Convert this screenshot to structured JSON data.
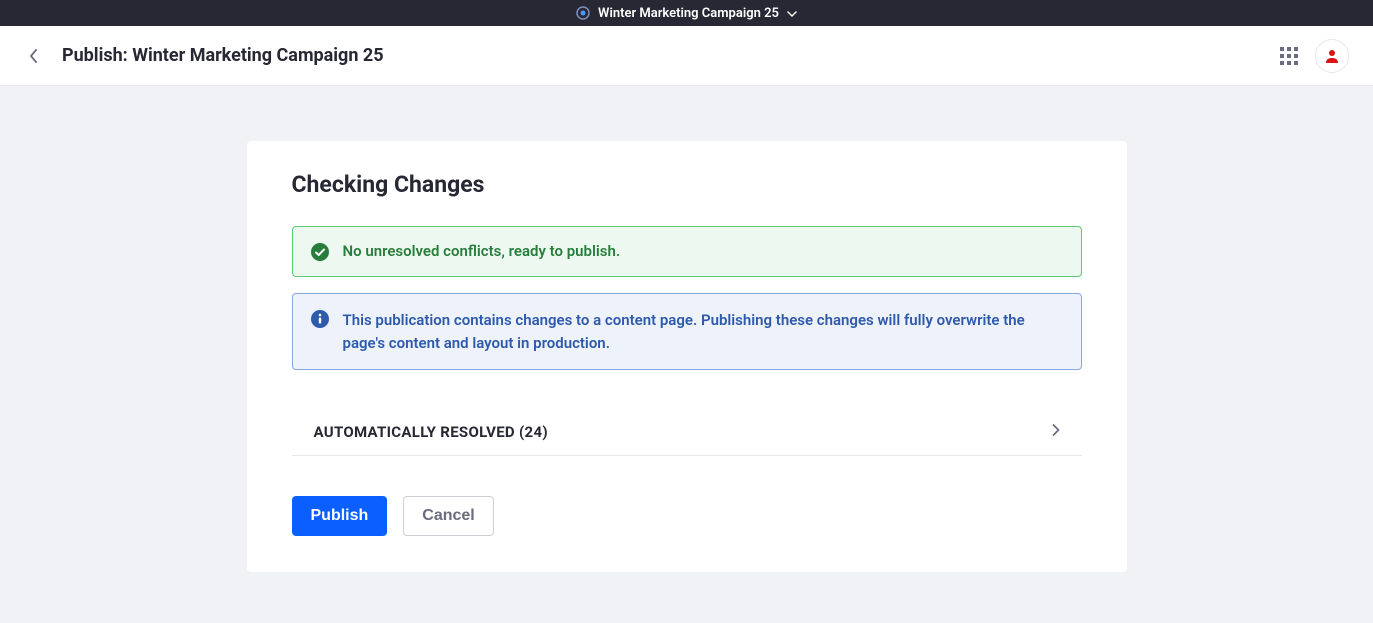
{
  "topbar": {
    "title": "Winter Marketing Campaign 25"
  },
  "header": {
    "title": "Publish: Winter Marketing Campaign 25"
  },
  "card": {
    "title": "Checking Changes",
    "success_message": "No unresolved conflicts, ready to publish.",
    "info_message": "This publication contains changes to a content page. Publishing these changes will fully overwrite the page's content and layout in production.",
    "resolved_section_label": "AUTOMATICALLY RESOLVED (24)"
  },
  "actions": {
    "publish_label": "Publish",
    "cancel_label": "Cancel"
  },
  "colors": {
    "primary": "#0b5fff",
    "success_border": "#5aca75",
    "success_text": "#287d3c",
    "info_border": "#89a7e0",
    "info_text": "#2e5aac",
    "avatar_accent": "#da1414"
  }
}
